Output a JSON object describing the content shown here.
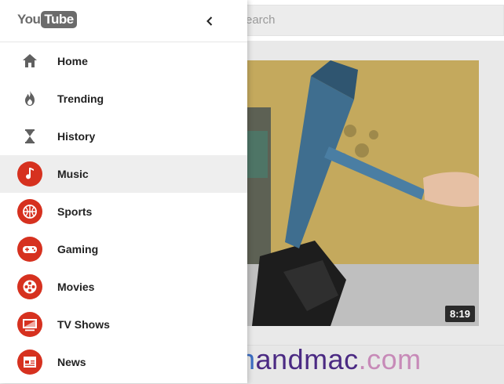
{
  "app": {
    "search_placeholder": "earch"
  },
  "video": {
    "duration": "8:19"
  },
  "watermark": {
    "part1": "win",
    "part2": "andmac",
    "part3": ".com"
  },
  "drawer": {
    "logo_you": "You",
    "logo_tube": "Tube",
    "items": [
      {
        "label": "Home",
        "icon": "home-icon",
        "active": false
      },
      {
        "label": "Trending",
        "icon": "trending-icon",
        "active": false
      },
      {
        "label": "History",
        "icon": "history-icon",
        "active": false
      },
      {
        "label": "Music",
        "icon": "music-icon",
        "active": true
      },
      {
        "label": "Sports",
        "icon": "sports-icon",
        "active": false
      },
      {
        "label": "Gaming",
        "icon": "gaming-icon",
        "active": false
      },
      {
        "label": "Movies",
        "icon": "movies-icon",
        "active": false
      },
      {
        "label": "TV Shows",
        "icon": "tv-shows-icon",
        "active": false
      },
      {
        "label": "News",
        "icon": "news-icon",
        "active": false
      }
    ]
  },
  "colors": {
    "category_red": "#d6311f",
    "gray_icon": "#606060"
  }
}
